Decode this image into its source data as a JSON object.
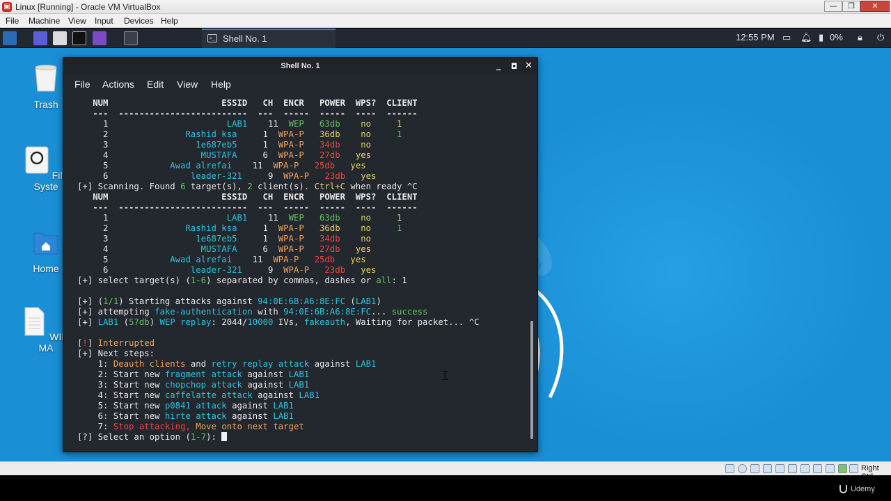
{
  "host": {
    "window_title": "Linux [Running] - Oracle VM VirtualBox",
    "menu": [
      "File",
      "Machine",
      "View",
      "Input",
      "Devices",
      "Help"
    ],
    "status_hostkey": "Right Ctrl",
    "watermark": "Udemy"
  },
  "taskbar": {
    "task_label": "Shell No. 1",
    "clock": "12:55 PM",
    "battery": "0%"
  },
  "desktop_icons": [
    {
      "label": "Trash"
    },
    {
      "label": "File Syste"
    },
    {
      "label": "Home"
    },
    {
      "label": "WIFI MA"
    }
  ],
  "terminal": {
    "title": "Shell No. 1",
    "menu": [
      "File",
      "Actions",
      "Edit",
      "View",
      "Help"
    ],
    "lines": [
      [
        [
          "   NUM                      ESSID   CH  ENCR   POWER  WPS?  CLIENT",
          "c-w c-bold"
        ]
      ],
      [
        [
          "   ---  -------------------------  ---  -----  -----  ----  ------",
          "c-w c-bold"
        ]
      ],
      [
        [
          "     1                       ",
          "c-w"
        ],
        [
          "LAB1",
          "c-cyan"
        ],
        [
          "    11  ",
          "c-w"
        ],
        [
          "WEP",
          "c-green"
        ],
        [
          "   63db",
          "c-green"
        ],
        [
          "    no     1",
          "c-yellow"
        ]
      ],
      [
        [
          "     2",
          "c-w"
        ],
        [
          "               Rashid ksa",
          "c-cyan"
        ],
        [
          "     1  ",
          "c-w"
        ],
        [
          "WPA-P",
          "c-orange"
        ],
        [
          "   36db",
          "c-yellow"
        ],
        [
          "    no     ",
          "c-yellow"
        ],
        [
          "1",
          "c-green"
        ]
      ],
      [
        [
          "     3",
          "c-w"
        ],
        [
          "                 1e687eb5",
          "c-cyan"
        ],
        [
          "     1  ",
          "c-w"
        ],
        [
          "WPA-P",
          "c-orange"
        ],
        [
          "   34db",
          "c-red"
        ],
        [
          "    no",
          "c-yellow"
        ]
      ],
      [
        [
          "     4",
          "c-w"
        ],
        [
          "                  MUSTAFA",
          "c-cyan"
        ],
        [
          "     6  ",
          "c-w"
        ],
        [
          "WPA-P",
          "c-orange"
        ],
        [
          "   27db",
          "c-red"
        ],
        [
          "   yes",
          "c-yellow"
        ]
      ],
      [
        [
          "     5",
          "c-w"
        ],
        [
          "            Awad alrefai",
          "c-cyan"
        ],
        [
          "    11  ",
          "c-w"
        ],
        [
          "WPA-P",
          "c-orange"
        ],
        [
          "   25db",
          "c-red"
        ],
        [
          "   yes",
          "c-yellow"
        ]
      ],
      [
        [
          "     6",
          "c-w"
        ],
        [
          "                leader-321",
          "c-cyan"
        ],
        [
          "     9  ",
          "c-w"
        ],
        [
          "WPA-P",
          "c-orange"
        ],
        [
          "   23db",
          "c-red"
        ],
        [
          "   yes",
          "c-yellow"
        ]
      ],
      [
        [
          "[+] Scanning. Found ",
          "c-w"
        ],
        [
          "6",
          "c-green"
        ],
        [
          " target(s), ",
          "c-w"
        ],
        [
          "2",
          "c-green"
        ],
        [
          " client(s). ",
          "c-w"
        ],
        [
          "Ctrl+C",
          "c-yellow"
        ],
        [
          " when ready ^C",
          "c-w"
        ]
      ],
      [
        [
          "   NUM                      ESSID   CH  ENCR   POWER  WPS?  CLIENT",
          "c-w c-bold"
        ]
      ],
      [
        [
          "   ---  -------------------------  ---  -----  -----  ----  ------",
          "c-w c-bold"
        ]
      ],
      [
        [
          "     1                       ",
          "c-w"
        ],
        [
          "LAB1",
          "c-cyan"
        ],
        [
          "    11  ",
          "c-w"
        ],
        [
          "WEP",
          "c-green"
        ],
        [
          "   63db",
          "c-green"
        ],
        [
          "    no     1",
          "c-yellow"
        ]
      ],
      [
        [
          "     2",
          "c-w"
        ],
        [
          "               Rashid ksa",
          "c-cyan"
        ],
        [
          "     1  ",
          "c-w"
        ],
        [
          "WPA-P",
          "c-orange"
        ],
        [
          "   36db",
          "c-yellow"
        ],
        [
          "    no     ",
          "c-yellow"
        ],
        [
          "1",
          "c-green"
        ]
      ],
      [
        [
          "     3",
          "c-w"
        ],
        [
          "                 1e687eb5",
          "c-cyan"
        ],
        [
          "     1  ",
          "c-w"
        ],
        [
          "WPA-P",
          "c-orange"
        ],
        [
          "   34db",
          "c-red"
        ],
        [
          "    no",
          "c-yellow"
        ]
      ],
      [
        [
          "     4",
          "c-w"
        ],
        [
          "                  MUSTAFA",
          "c-cyan"
        ],
        [
          "     6  ",
          "c-w"
        ],
        [
          "WPA-P",
          "c-orange"
        ],
        [
          "   27db",
          "c-red"
        ],
        [
          "   yes",
          "c-yellow"
        ]
      ],
      [
        [
          "     5",
          "c-w"
        ],
        [
          "            Awad alrefai",
          "c-cyan"
        ],
        [
          "    11  ",
          "c-w"
        ],
        [
          "WPA-P",
          "c-orange"
        ],
        [
          "   25db",
          "c-red"
        ],
        [
          "   yes",
          "c-yellow"
        ]
      ],
      [
        [
          "     6",
          "c-w"
        ],
        [
          "                leader-321",
          "c-cyan"
        ],
        [
          "     9  ",
          "c-w"
        ],
        [
          "WPA-P",
          "c-orange"
        ],
        [
          "   23db",
          "c-red"
        ],
        [
          "   yes",
          "c-yellow"
        ]
      ],
      [
        [
          "[+] select target(s) (",
          "c-w"
        ],
        [
          "1-6",
          "c-green"
        ],
        [
          ") separated by commas, dashes or ",
          "c-w"
        ],
        [
          "all",
          "c-green"
        ],
        [
          ": 1",
          "c-w"
        ]
      ],
      [
        [
          "",
          "c-w"
        ]
      ],
      [
        [
          "[+] (",
          "c-w"
        ],
        [
          "1/1",
          "c-green"
        ],
        [
          ") Starting attacks against ",
          "c-w"
        ],
        [
          "94:0E:6B:A6:8E:FC",
          "c-cyan"
        ],
        [
          " (",
          "c-w"
        ],
        [
          "LAB1",
          "c-cyan"
        ],
        [
          ")",
          "c-w"
        ]
      ],
      [
        [
          "[+] attempting ",
          "c-w"
        ],
        [
          "fake-authentication",
          "c-cyan"
        ],
        [
          " with ",
          "c-w"
        ],
        [
          "94:0E:6B:A6:8E:FC",
          "c-cyan"
        ],
        [
          "... ",
          "c-w"
        ],
        [
          "success",
          "c-green"
        ]
      ],
      [
        [
          "[+] ",
          "c-w"
        ],
        [
          "LAB1",
          "c-cyan"
        ],
        [
          " (",
          "c-w"
        ],
        [
          "57db",
          "c-green"
        ],
        [
          ") ",
          "c-w"
        ],
        [
          "WEP replay",
          "c-cyan"
        ],
        [
          ": 2044/",
          "c-w"
        ],
        [
          "10000",
          "c-cyan"
        ],
        [
          " IVs, ",
          "c-w"
        ],
        [
          "fakeauth",
          "c-cyan"
        ],
        [
          ", Waiting for packet... ^C",
          "c-w"
        ]
      ],
      [
        [
          "",
          "c-w"
        ]
      ],
      [
        [
          "[",
          "c-w"
        ],
        [
          "!",
          "c-red"
        ],
        [
          "] ",
          "c-w"
        ],
        [
          "Interrupted",
          "c-orange"
        ]
      ],
      [
        [
          "[+] Next steps:",
          "c-w"
        ]
      ],
      [
        [
          "    1: ",
          "c-w"
        ],
        [
          "Deauth clients",
          "c-orange"
        ],
        [
          " and ",
          "c-w"
        ],
        [
          "retry",
          "c-cyan"
        ],
        [
          " ",
          "c-w"
        ],
        [
          "replay attack",
          "c-cyan"
        ],
        [
          " against ",
          "c-w"
        ],
        [
          "LAB1",
          "c-cyan"
        ]
      ],
      [
        [
          "    2: Start new ",
          "c-w"
        ],
        [
          "fragment attack",
          "c-cyan"
        ],
        [
          " against ",
          "c-w"
        ],
        [
          "LAB1",
          "c-cyan"
        ]
      ],
      [
        [
          "    3: Start new ",
          "c-w"
        ],
        [
          "chopchop attack",
          "c-cyan"
        ],
        [
          " against ",
          "c-w"
        ],
        [
          "LAB1",
          "c-cyan"
        ]
      ],
      [
        [
          "    4: Start new ",
          "c-w"
        ],
        [
          "caffelatte attack",
          "c-cyan"
        ],
        [
          " against ",
          "c-w"
        ],
        [
          "LAB1",
          "c-cyan"
        ]
      ],
      [
        [
          "    5: Start new ",
          "c-w"
        ],
        [
          "p0841 attack",
          "c-cyan"
        ],
        [
          " against ",
          "c-w"
        ],
        [
          "LAB1",
          "c-cyan"
        ]
      ],
      [
        [
          "    6: Start new ",
          "c-w"
        ],
        [
          "hirte attack",
          "c-cyan"
        ],
        [
          " against ",
          "c-w"
        ],
        [
          "LAB1",
          "c-cyan"
        ]
      ],
      [
        [
          "    7: ",
          "c-w"
        ],
        [
          "Stop attacking, ",
          "c-red"
        ],
        [
          "Move onto next target",
          "c-orange"
        ]
      ],
      [
        [
          "[?] Select an option (",
          "c-w"
        ],
        [
          "1-7",
          "c-green"
        ],
        [
          "): ",
          "c-w"
        ]
      ]
    ]
  }
}
